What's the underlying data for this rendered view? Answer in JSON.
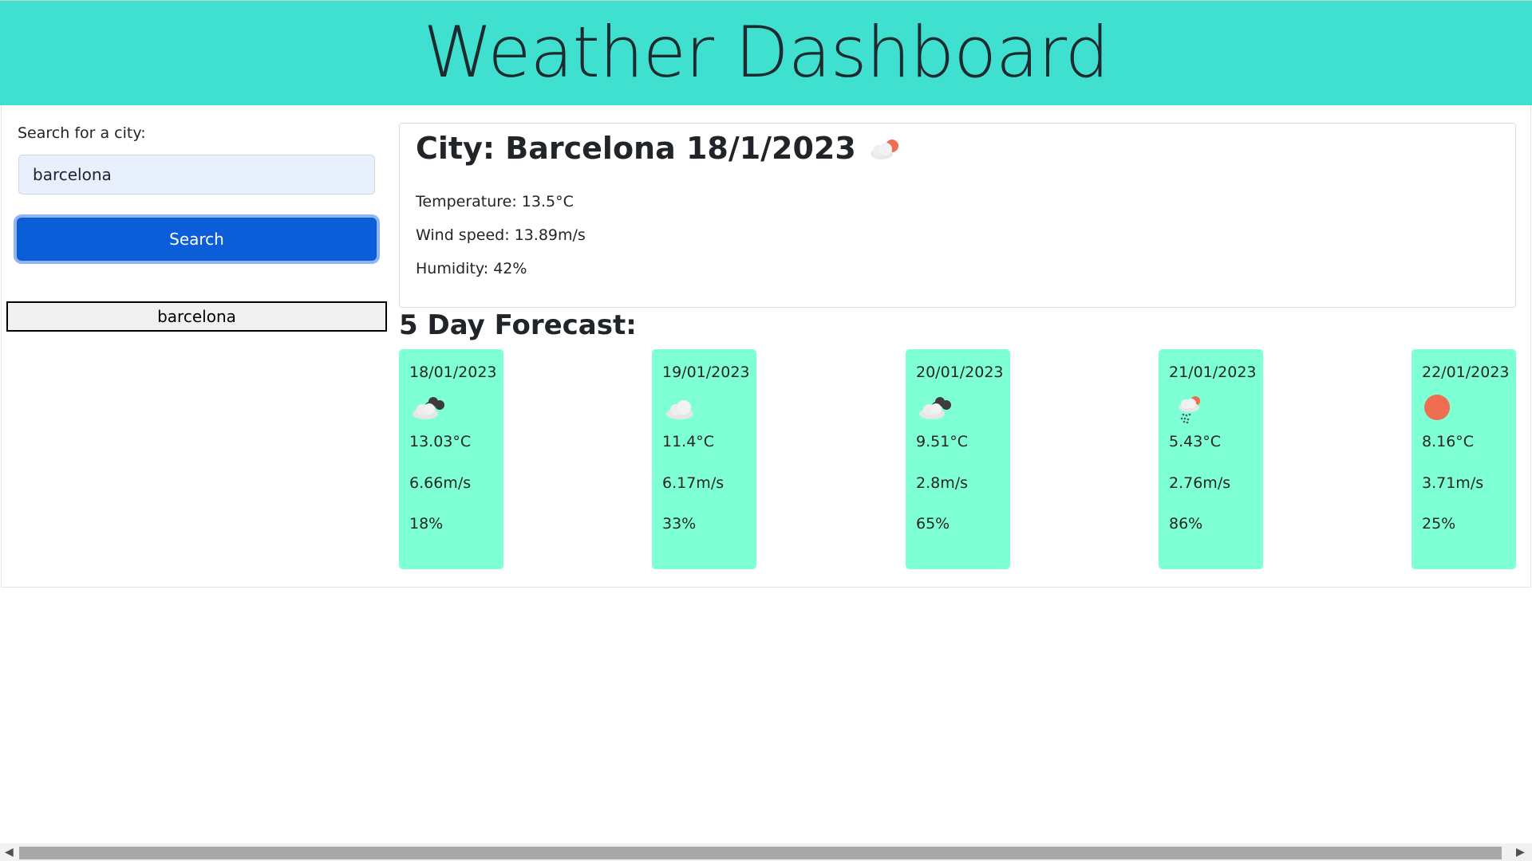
{
  "header": {
    "title": "Weather Dashboard"
  },
  "search": {
    "label": "Search for a city:",
    "value": "barcelona",
    "button_label": "Search",
    "history": [
      "barcelona"
    ]
  },
  "current": {
    "title": "City: Barcelona 18/1/2023",
    "icon": "partly-cloudy-sun-icon",
    "temperature": "Temperature: 13.5°C",
    "wind": "Wind speed: 13.89m/s",
    "humidity": "Humidity: 42%"
  },
  "forecast": {
    "title": "5 Day Forecast:",
    "days": [
      {
        "date": "18/01/2023",
        "icon": "broken-clouds-icon",
        "temp": "13.03°C",
        "wind": "6.66m/s",
        "humidity": "18%"
      },
      {
        "date": "19/01/2023",
        "icon": "cloud-icon",
        "temp": "11.4°C",
        "wind": "6.17m/s",
        "humidity": "33%"
      },
      {
        "date": "20/01/2023",
        "icon": "broken-clouds-icon",
        "temp": "9.51°C",
        "wind": "2.8m/s",
        "humidity": "65%"
      },
      {
        "date": "21/01/2023",
        "icon": "rain-sun-icon",
        "temp": "5.43°C",
        "wind": "2.76m/s",
        "humidity": "86%"
      },
      {
        "date": "22/01/2023",
        "icon": "sun-icon",
        "temp": "8.16°C",
        "wind": "3.71m/s",
        "humidity": "25%"
      }
    ]
  },
  "colors": {
    "header_bg": "#40e0d0",
    "card_bg": "#7fffd4",
    "button_bg": "#0b5ed7",
    "sun": "#ee6e4f"
  }
}
